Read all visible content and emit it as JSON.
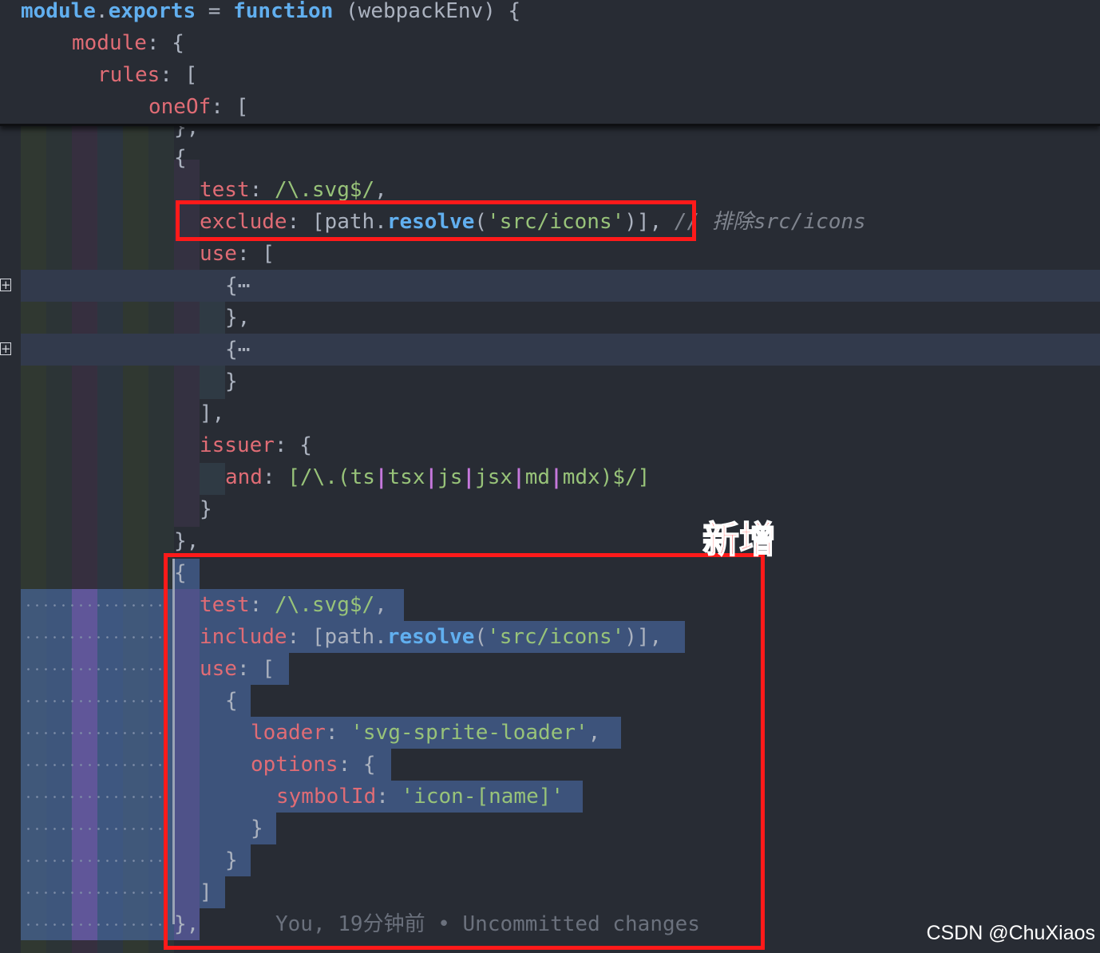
{
  "editor": {
    "sticky_header": [
      {
        "kw1": "module",
        "dot": ".",
        "kw2": "exports",
        "eq": " = ",
        "fn": "function",
        "args": " (webpackEnv) {"
      },
      {
        "prop": "module",
        "rest": ": {"
      },
      {
        "prop": "rules",
        "rest": ": ["
      },
      {
        "prop": "oneOf",
        "rest": ": ["
      }
    ],
    "first_rule": {
      "partial_top": "},",
      "open": "{",
      "test_key": "test",
      "test_val": "/\\.svg$/",
      "exclude_key": "exclude",
      "path_obj": "path",
      "resolve": "resolve",
      "exclude_path": "'src/icons'",
      "exclude_comment": "// 排除src/icons",
      "use_key": "use",
      "folded": "{⋯",
      "folded_close_1": "},",
      "folded_close_2": "}",
      "use_close": "],",
      "issuer_key": "issuer",
      "and_key": "and",
      "and_open": "[/\\.(",
      "exts": [
        "ts",
        "tsx",
        "js",
        "jsx",
        "md",
        "mdx"
      ],
      "and_close": ")$/]",
      "issuer_close": "}",
      "rule_close": "},"
    },
    "new_rule": {
      "open": "{",
      "test_key": "test",
      "test_val": "/\\.svg$/",
      "include_key": "include",
      "include_path": "'src/icons'",
      "use_key": "use",
      "loader_key": "loader",
      "loader_val": "'svg-sprite-loader'",
      "options_key": "options",
      "symbol_key": "symbolId",
      "symbol_val": "'icon-[name]'",
      "close": "},"
    },
    "blame": "You, 19分钟前 • Uncommitted changes",
    "annotation_label": "新增"
  },
  "watermark": "CSDN @ChuXiaos",
  "colors": {
    "highlight_box": "#ff1a1a",
    "background": "#282c34",
    "selection": "#4a6ca8"
  }
}
